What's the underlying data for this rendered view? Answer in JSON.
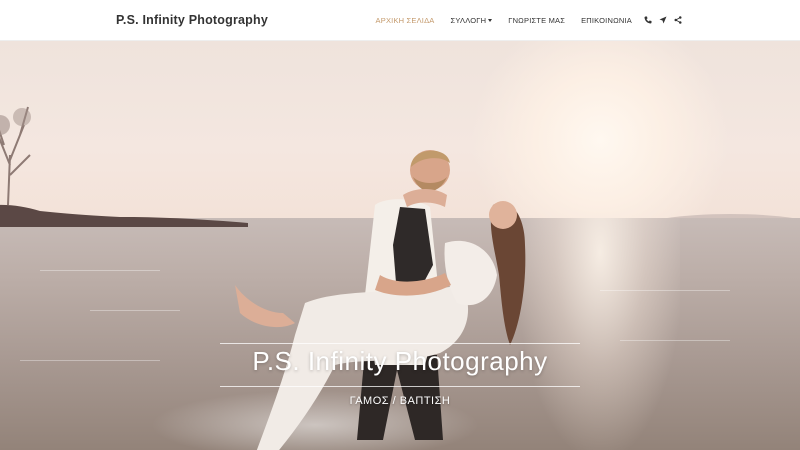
{
  "navbar": {
    "brand": "P.S. Infinity Photography",
    "items": [
      {
        "label": "ΑΡΧΙΚΗ ΣΕΛΙΔΑ",
        "active": true
      },
      {
        "label": "ΣΥΛΛΟΓΗ",
        "has_dropdown": true
      },
      {
        "label": "ΓΝΩΡΙΣΤΕ ΜΑΣ"
      },
      {
        "label": "ΕΠΙΚΟΙΝΩΝΙΑ"
      }
    ],
    "icons": [
      "phone-icon",
      "location-arrow-icon",
      "share-icon"
    ],
    "active_color": "#c49a6c"
  },
  "hero": {
    "title": "P.S. Infinity Photography",
    "subtitle": "ΓΑΜΟΣ / ΒΑΠΤΙΣΗ"
  }
}
